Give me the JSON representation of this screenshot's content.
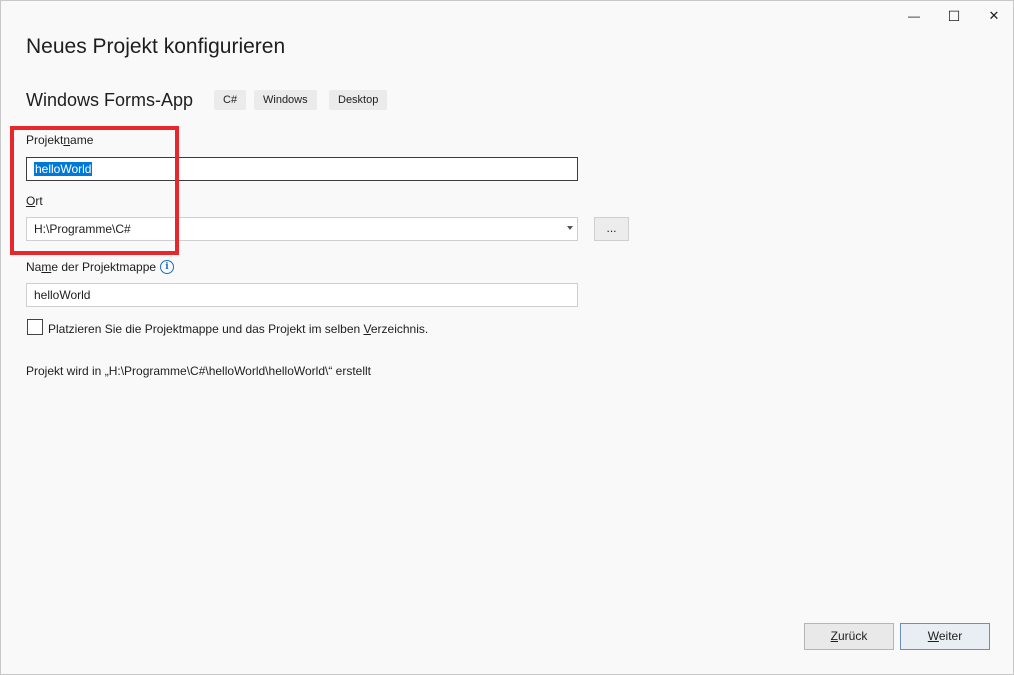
{
  "window": {
    "minimize_glyph": "—",
    "maximize_glyph": "☐",
    "close_glyph": "✕"
  },
  "header": {
    "title": "Neues Projekt konfigurieren",
    "template_name": "Windows Forms-App",
    "tags": [
      "C#",
      "Windows",
      "Desktop"
    ]
  },
  "form": {
    "project_name_label_pre": "Projekt",
    "project_name_label_key": "n",
    "project_name_label_post": "ame",
    "project_name_value": "helloWorld",
    "location_label_key": "O",
    "location_label_post": "rt",
    "location_value": "H:\\Programme\\C#",
    "browse_label": "...",
    "solution_name_label_pre": "Na",
    "solution_name_label_key": "m",
    "solution_name_label_post": "e der Projektmappe",
    "solution_name_value": "helloWorld",
    "same_dir_label_pre": "Platzieren Sie die Projektmappe und das Projekt im selben ",
    "same_dir_label_key": "V",
    "same_dir_label_post": "erzeichnis.",
    "same_dir_checked": false,
    "path_info": "Projekt wird in „H:\\Programme\\C#\\helloWorld\\helloWorld\\“ erstellt"
  },
  "footer": {
    "back_label_key": "Z",
    "back_label_post": "urück",
    "next_label_key": "W",
    "next_label_post": "eiter"
  },
  "colors": {
    "highlight_box": "#e8262b",
    "selection": "#0078d7",
    "info_icon": "#1a6fc0"
  },
  "icons": {
    "info": "info-icon",
    "dropdown": "chevron-down-icon"
  }
}
